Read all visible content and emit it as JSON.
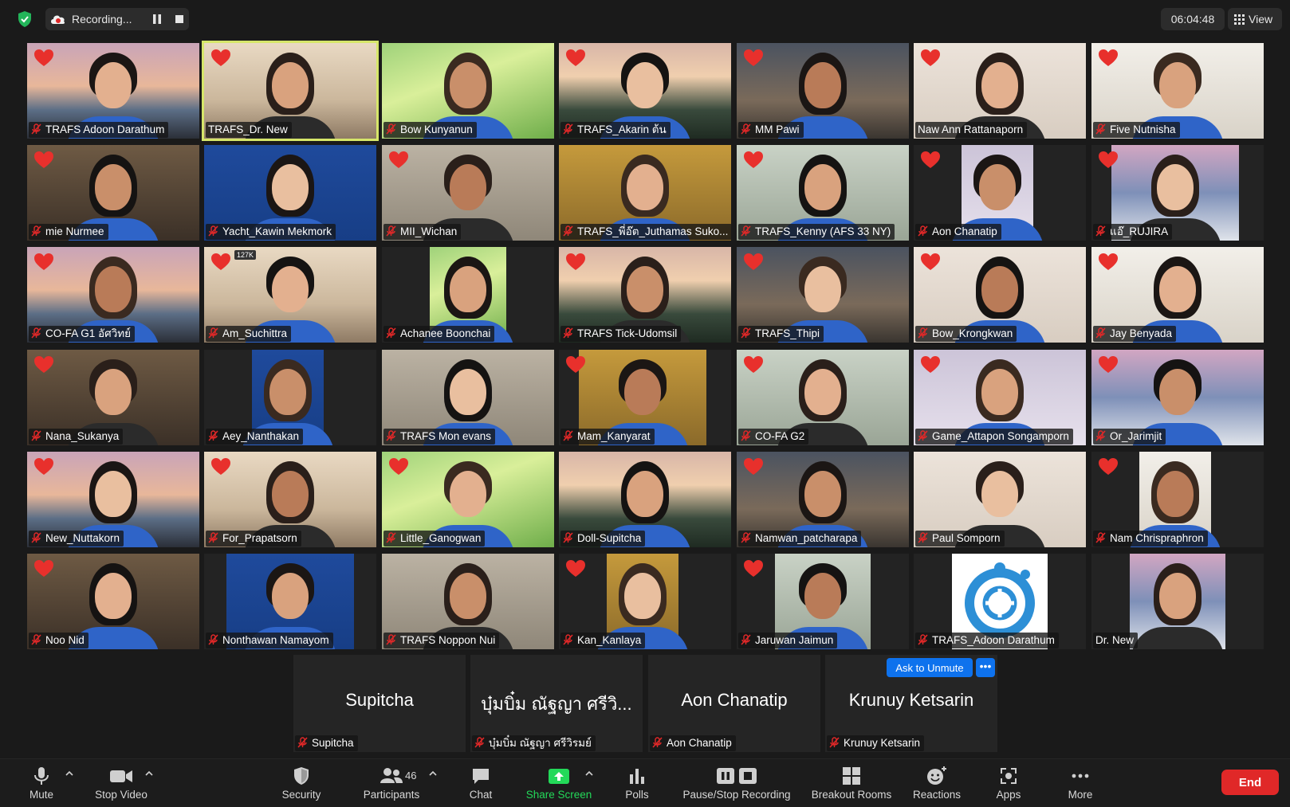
{
  "topbar": {
    "recording_label": "Recording...",
    "timer": "06:04:48",
    "view_label": "View"
  },
  "colors": {
    "heart": "#e8302c",
    "active_speaker_border": "#d6e66a",
    "end_button": "#e02828",
    "share_screen": "#23d959",
    "ask_unmute": "#0e72ed"
  },
  "participants": [
    {
      "name": "TRAFS Adoon Darathum",
      "heart": true,
      "muted": true
    },
    {
      "name": "TRAFS_Dr. New",
      "heart": true,
      "muted": false,
      "active": true
    },
    {
      "name": "Bow Kunyanun",
      "heart": false,
      "muted": true
    },
    {
      "name": "TRAFS_Akarin ต้น",
      "heart": true,
      "muted": true
    },
    {
      "name": "MM Pawi",
      "heart": true,
      "muted": true
    },
    {
      "name": "Naw Ann Rattanaporn",
      "heart": true,
      "muted": false
    },
    {
      "name": "Five Nutnisha",
      "heart": true,
      "muted": true
    },
    {
      "name": "mie Nurmee",
      "heart": true,
      "muted": true
    },
    {
      "name": "Yacht_Kawin Mekmork",
      "heart": false,
      "muted": true
    },
    {
      "name": "MII_Wichan",
      "heart": true,
      "muted": true
    },
    {
      "name": "TRAFS_พี่อ๊ต_Juthamas Suko...",
      "heart": false,
      "muted": true
    },
    {
      "name": "TRAFS_Kenny (AFS 33 NY)",
      "heart": true,
      "muted": true
    },
    {
      "name": "Aon Chanatip",
      "heart": true,
      "muted": true
    },
    {
      "name": "แอ๊_RUJIRA",
      "heart": true,
      "muted": true
    },
    {
      "name": "CO-FA G1 อัศวิทย์",
      "heart": true,
      "muted": true
    },
    {
      "name": "Am_Suchittra",
      "heart": true,
      "muted": true
    },
    {
      "name": "Achanee Boonchai",
      "heart": false,
      "muted": true
    },
    {
      "name": "TRAFS Tick-Udomsil",
      "heart": true,
      "muted": true
    },
    {
      "name": "TRAFS_Thipi",
      "heart": true,
      "muted": true
    },
    {
      "name": "Bow_Krongkwan",
      "heart": true,
      "muted": true
    },
    {
      "name": "Jay Benyada",
      "heart": true,
      "muted": true
    },
    {
      "name": "Nana_Sukanya",
      "heart": true,
      "muted": true
    },
    {
      "name": "Aey_Nanthakan",
      "heart": false,
      "muted": true
    },
    {
      "name": "TRAFS Mon evans",
      "heart": false,
      "muted": true
    },
    {
      "name": "Mam_Kanyarat",
      "heart": true,
      "muted": true
    },
    {
      "name": "CO-FA G2",
      "heart": true,
      "muted": true
    },
    {
      "name": "Game_Attapon Songamporn",
      "heart": true,
      "muted": true
    },
    {
      "name": "Or_Jarimjit",
      "heart": true,
      "muted": true
    },
    {
      "name": "New_Nuttakorn",
      "heart": true,
      "muted": true
    },
    {
      "name": "For_Prapatsorn",
      "heart": true,
      "muted": true
    },
    {
      "name": "Little_Ganogwan",
      "heart": true,
      "muted": true
    },
    {
      "name": "Doll-Supitcha",
      "heart": false,
      "muted": true
    },
    {
      "name": "Namwan_patcharapa",
      "heart": true,
      "muted": true
    },
    {
      "name": "Paul Somporn",
      "heart": false,
      "muted": true
    },
    {
      "name": "Nam Chrispraphron",
      "heart": true,
      "muted": true
    },
    {
      "name": "Noo Nid",
      "heart": true,
      "muted": true
    },
    {
      "name": "Nonthawan Namayom",
      "heart": false,
      "muted": true
    },
    {
      "name": "TRAFS Noppon Nui",
      "heart": false,
      "muted": true
    },
    {
      "name": "Kan_Kanlaya",
      "heart": true,
      "muted": true
    },
    {
      "name": "Jaruwan Jaimun",
      "heart": true,
      "muted": true
    },
    {
      "name": "TRAFS_Adoon Darathum",
      "heart": false,
      "muted": true
    },
    {
      "name": "Dr. New",
      "heart": false,
      "muted": false
    }
  ],
  "overlay_badge": "127K",
  "name_tiles": [
    {
      "big_name": "Supitcha",
      "label": "Supitcha"
    },
    {
      "big_name": "บุ๋มบิ๋ม ณัฐญา ศรีวิ...",
      "label": "บุ๋มบิ๋ม ณัฐญา ศรีวิรมย์"
    },
    {
      "big_name": "Aon Chanatip",
      "label": "Aon Chanatip"
    },
    {
      "big_name": "Krunuy Ketsarin",
      "label": "Krunuy Ketsarin"
    }
  ],
  "ask_to_unmute_label": "Ask to Unmute",
  "more_dots": "•••",
  "toolbar": {
    "mute": "Mute",
    "stop_video": "Stop Video",
    "security": "Security",
    "participants": "Participants",
    "participants_count": "46",
    "chat": "Chat",
    "share_screen": "Share Screen",
    "polls": "Polls",
    "pause_stop_recording": "Pause/Stop Recording",
    "breakout_rooms": "Breakout Rooms",
    "reactions": "Reactions",
    "apps": "Apps",
    "more": "More",
    "end": "End"
  }
}
